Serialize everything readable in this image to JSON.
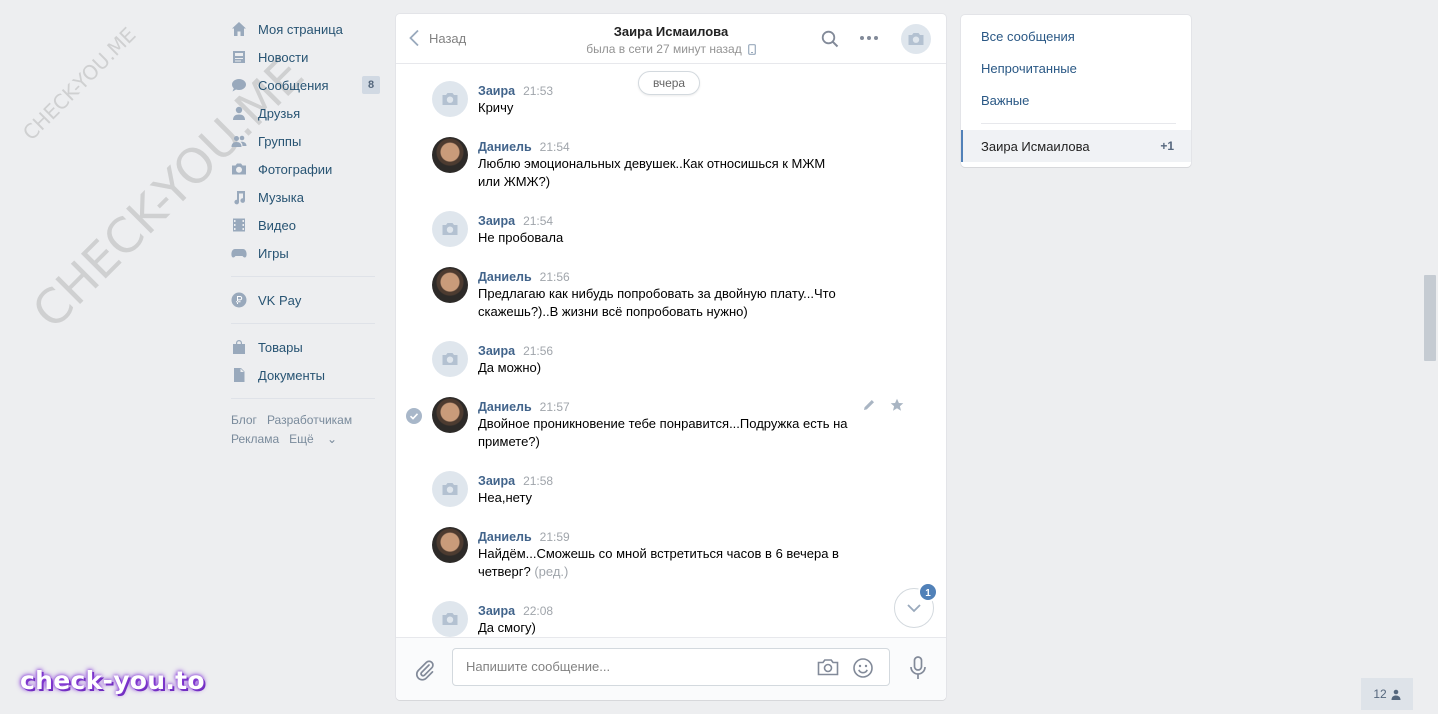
{
  "watermark": {
    "small": "CHECK-YOU.ME",
    "big": "CHECK-YOU.ME",
    "brand": "check-you.to"
  },
  "leftnav": {
    "items": [
      {
        "label": "Моя страница",
        "icon": "home-icon"
      },
      {
        "label": "Новости",
        "icon": "news-icon"
      },
      {
        "label": "Сообщения",
        "icon": "messages-icon",
        "badge": "8"
      },
      {
        "label": "Друзья",
        "icon": "friend-icon"
      },
      {
        "label": "Группы",
        "icon": "groups-icon"
      },
      {
        "label": "Фотографии",
        "icon": "camera-icon"
      },
      {
        "label": "Музыка",
        "icon": "music-icon"
      },
      {
        "label": "Видео",
        "icon": "video-icon"
      },
      {
        "label": "Игры",
        "icon": "gamepad-icon"
      }
    ],
    "vkpay": "VK Pay",
    "shop": "Товары",
    "docs": "Документы",
    "footer": {
      "blog": "Блог",
      "dev": "Разработчикам",
      "ads": "Реклама",
      "more": "Ещё"
    }
  },
  "header": {
    "back": "Назад",
    "peer_name": "Заира Исмаилова",
    "peer_status": "была в сети 27 минут назад"
  },
  "date_pill": "вчера",
  "messages": [
    {
      "author": "Заира",
      "time": "21:53",
      "lines": [
        "Кричу"
      ]
    },
    {
      "author": "Даниель",
      "time": "21:54",
      "lines": [
        "Люблю эмоциональных девушек..Как относишься к МЖМ",
        "или ЖМЖ?)"
      ]
    },
    {
      "author": "Заира",
      "time": "21:54",
      "lines": [
        "Не пробовала"
      ]
    },
    {
      "author": "Даниель",
      "time": "21:56",
      "lines": [
        "Предлагаю как нибудь попробовать за двойную плату...Что",
        "скажешь?)..В жизни всё попробовать нужно)"
      ]
    },
    {
      "author": "Заира",
      "time": "21:56",
      "lines": [
        "Да можно)"
      ]
    },
    {
      "author": "Даниель",
      "time": "21:57",
      "lines": [
        "Двойное проникновение тебе понравится...Подружка есть на",
        "примете?)"
      ]
    },
    {
      "author": "Заира",
      "time": "21:58",
      "lines": [
        "Неа,нету"
      ]
    },
    {
      "author": "Даниель",
      "time": "21:59",
      "lines": [
        "Найдём...Сможешь со мной встретиться часов в 6 вечера в",
        "четверг?"
      ],
      "edited": "(ред.)"
    },
    {
      "author": "Заира",
      "time": "22:08",
      "lines": [
        "Да смогу)"
      ]
    }
  ],
  "scroll_badge": "1",
  "composer": {
    "placeholder": "Напишите сообщение..."
  },
  "rightpanel": {
    "all": "Все сообщения",
    "unread": "Непрочитанные",
    "important": "Важные",
    "conv_name": "Заира Исмаилова",
    "conv_count": "+1"
  },
  "online_count": "12",
  "colors": {
    "link": "#2a5885",
    "author": "#42648b",
    "accent": "#5181b8",
    "bg": "#edeef0"
  }
}
